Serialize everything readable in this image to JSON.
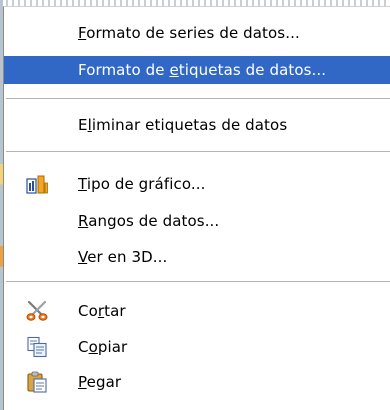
{
  "menu": {
    "items": [
      {
        "pre": "",
        "mn": "F",
        "post": "ormato de series de datos..."
      },
      {
        "pre": "Formato de ",
        "mn": "e",
        "post": "tiquetas de datos..."
      },
      {
        "pre": "E",
        "mn": "l",
        "post": "iminar etiquetas de datos"
      },
      {
        "pre": "",
        "mn": "T",
        "post": "ipo de gráfico..."
      },
      {
        "pre": "",
        "mn": "R",
        "post": "angos de datos..."
      },
      {
        "pre": "",
        "mn": "V",
        "post": "er en 3D..."
      },
      {
        "pre": "Co",
        "mn": "r",
        "post": "tar"
      },
      {
        "pre": "C",
        "mn": "o",
        "post": "piar"
      },
      {
        "pre": "",
        "mn": "P",
        "post": "egar"
      }
    ],
    "highlighted_index": 1,
    "highlight_color": "#3168c6",
    "icons": {
      "chart_type": "chart-type-icon",
      "cut": "scissors-icon",
      "copy": "copy-icon",
      "paste": "paste-icon"
    }
  }
}
